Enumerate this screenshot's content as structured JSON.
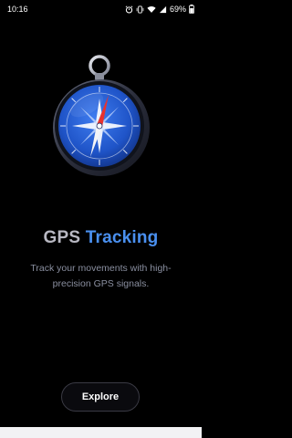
{
  "status_bar": {
    "time": "10:16",
    "battery": "69%",
    "icons": [
      "alarm-icon",
      "vibrate-icon",
      "wifi-icon",
      "signal-icon",
      "battery-icon"
    ]
  },
  "hero": {
    "image_icon": "compass-icon",
    "title_word1": "GPS",
    "title_word2": "Tracking",
    "subtitle": "Track your movements with high-precision GPS signals."
  },
  "actions": {
    "explore_label": "Explore"
  },
  "colors": {
    "background": "#000000",
    "accent": "#4a90f0",
    "title_gray": "#b8b8c2",
    "subtitle_gray": "#8a8fa0"
  }
}
